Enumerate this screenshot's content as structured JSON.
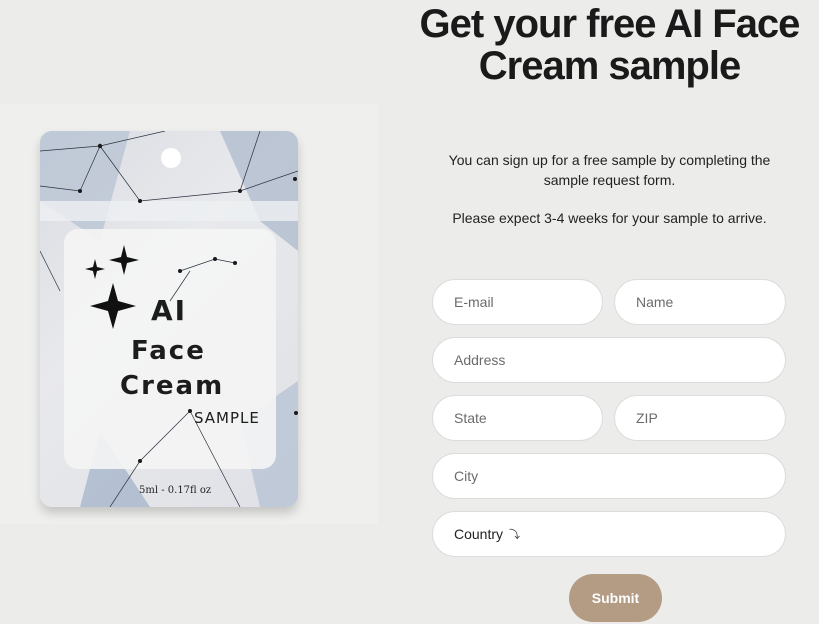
{
  "page": {
    "headline": "Get your free AI Face Cream sample",
    "intro": "You can sign up for a free sample by completing the sample request form.",
    "notice": "Please expect 3-4 weeks for your sample to arrive."
  },
  "product": {
    "line1": "AI",
    "line2": "Face",
    "line3": "Cream",
    "tag": "SAMPLE",
    "volume": "5ml - 0.17fl oz"
  },
  "form": {
    "email_placeholder": "E-mail",
    "name_placeholder": "Name",
    "address_placeholder": "Address",
    "state_placeholder": "State",
    "zip_placeholder": "ZIP",
    "city_placeholder": "City",
    "country_selected": "Country",
    "country_arrow_icon": "curved-arrow-down-icon",
    "submit_label": "Submit"
  },
  "colors": {
    "background": "#ececea",
    "submit": "#b39b84",
    "headline": "#1a1a1a"
  }
}
